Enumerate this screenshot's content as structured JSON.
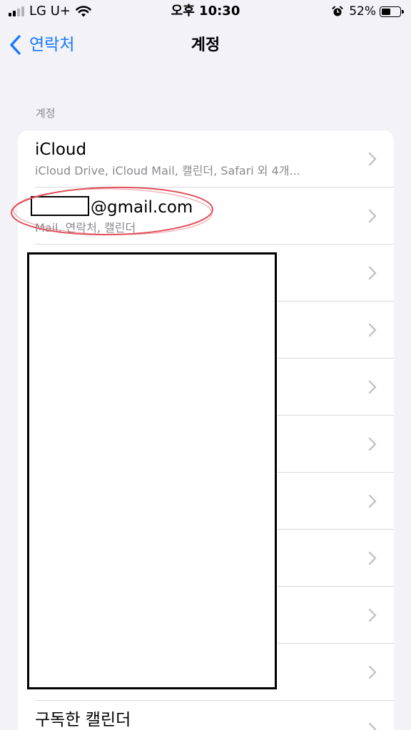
{
  "status_bar": {
    "carrier": "LG U+",
    "time": "오후 10:30",
    "battery_percent": "52%",
    "battery_level": 0.52,
    "icons": [
      "signal-icon",
      "wifi-icon",
      "alarm-icon",
      "battery-icon"
    ]
  },
  "nav": {
    "back_label": "연락처",
    "title": "계정"
  },
  "section": {
    "header": "계정"
  },
  "accounts": [
    {
      "title": "iCloud",
      "subtitle": "iCloud Drive, iCloud Mail, 캘린더, Safari 외 4개..."
    },
    {
      "title": "@gmail.com",
      "subtitle": "Mail, 연락처, 캘린더"
    }
  ],
  "last_row": {
    "title": "구독한 캘린더"
  },
  "colors": {
    "accent": "#1a78ff",
    "background": "#f2f2f7",
    "secondary_text": "#8a8a8e",
    "annotation": "#e0505a"
  }
}
